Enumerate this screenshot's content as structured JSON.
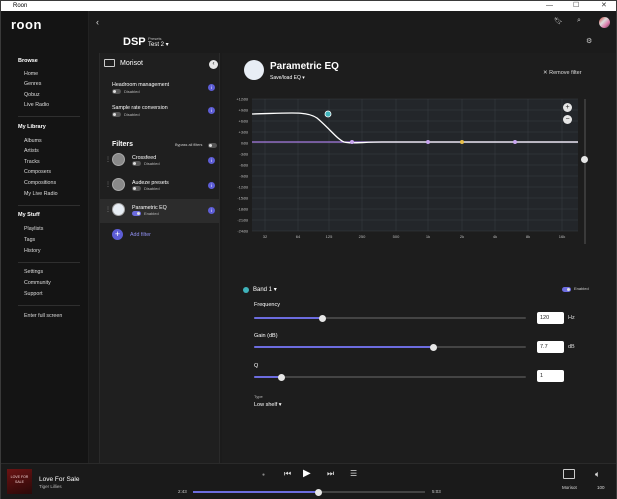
{
  "window": {
    "title": "Roon"
  },
  "sidebar": {
    "logo": "roon",
    "browse_header": "Browse",
    "browse_items": [
      "Home",
      "Genres",
      "Qobuz",
      "Live Radio"
    ],
    "library_header": "My Library",
    "library_items": [
      "Albums",
      "Artists",
      "Tracks",
      "Composers",
      "Compositions",
      "My Live Radio"
    ],
    "stuff_header": "My Stuff",
    "stuff_items": [
      "Playlists",
      "Tags",
      "History"
    ],
    "misc_items": [
      "Settings",
      "Community",
      "Support"
    ],
    "fullscreen": "Enter full screen"
  },
  "header": {
    "title": "DSP",
    "presets_label": "Presets",
    "preset_value": "Test 2"
  },
  "left_panel": {
    "zone_name": "Morisot",
    "headroom": {
      "title": "Headroom management",
      "status": "Disabled"
    },
    "src": {
      "title": "Sample rate conversion",
      "status": "Disabled"
    },
    "filters_title": "Filters",
    "bypass_label": "Bypass all filters",
    "filters": [
      {
        "name": "Crossfeed",
        "status": "Disabled"
      },
      {
        "name": "Audeze presets",
        "status": "Disabled"
      },
      {
        "name": "Parametric EQ",
        "status": "Enabled"
      }
    ],
    "add_filter": "Add filter"
  },
  "peq": {
    "title": "Parametric EQ",
    "save_load": "Save/load EQ",
    "remove": "Remove filter",
    "y_labels": [
      "+12dB",
      "+9dB",
      "+6dB",
      "+3dB",
      "0dB",
      "-3dB",
      "-6dB",
      "-9dB",
      "-12dB",
      "-15dB",
      "-18dB",
      "-21dB",
      "-24dB"
    ],
    "x_labels": [
      "32",
      "64",
      "125",
      "250",
      "500",
      "1k",
      "2k",
      "4k",
      "8k",
      "16k"
    ],
    "band_label": "Band 1",
    "band_enabled": "Enabled",
    "frequency": {
      "label": "Frequency",
      "value": "120",
      "unit": "Hz",
      "position": 0.25
    },
    "gain": {
      "label": "Gain (dB)",
      "value": "7.7",
      "unit": "dB",
      "position": 0.66
    },
    "q": {
      "label": "Q",
      "value": "1",
      "position": 0.1
    },
    "type_label": "Type",
    "type_value": "Low shelf"
  },
  "player": {
    "track_title": "Love For Sale",
    "artist": "Tiger Lillies",
    "album_art_text": "LOVE FOR SALE",
    "elapsed": "2:43",
    "total": "5:03",
    "progress": 0.54,
    "zone": "Morisot",
    "volume": "100"
  }
}
